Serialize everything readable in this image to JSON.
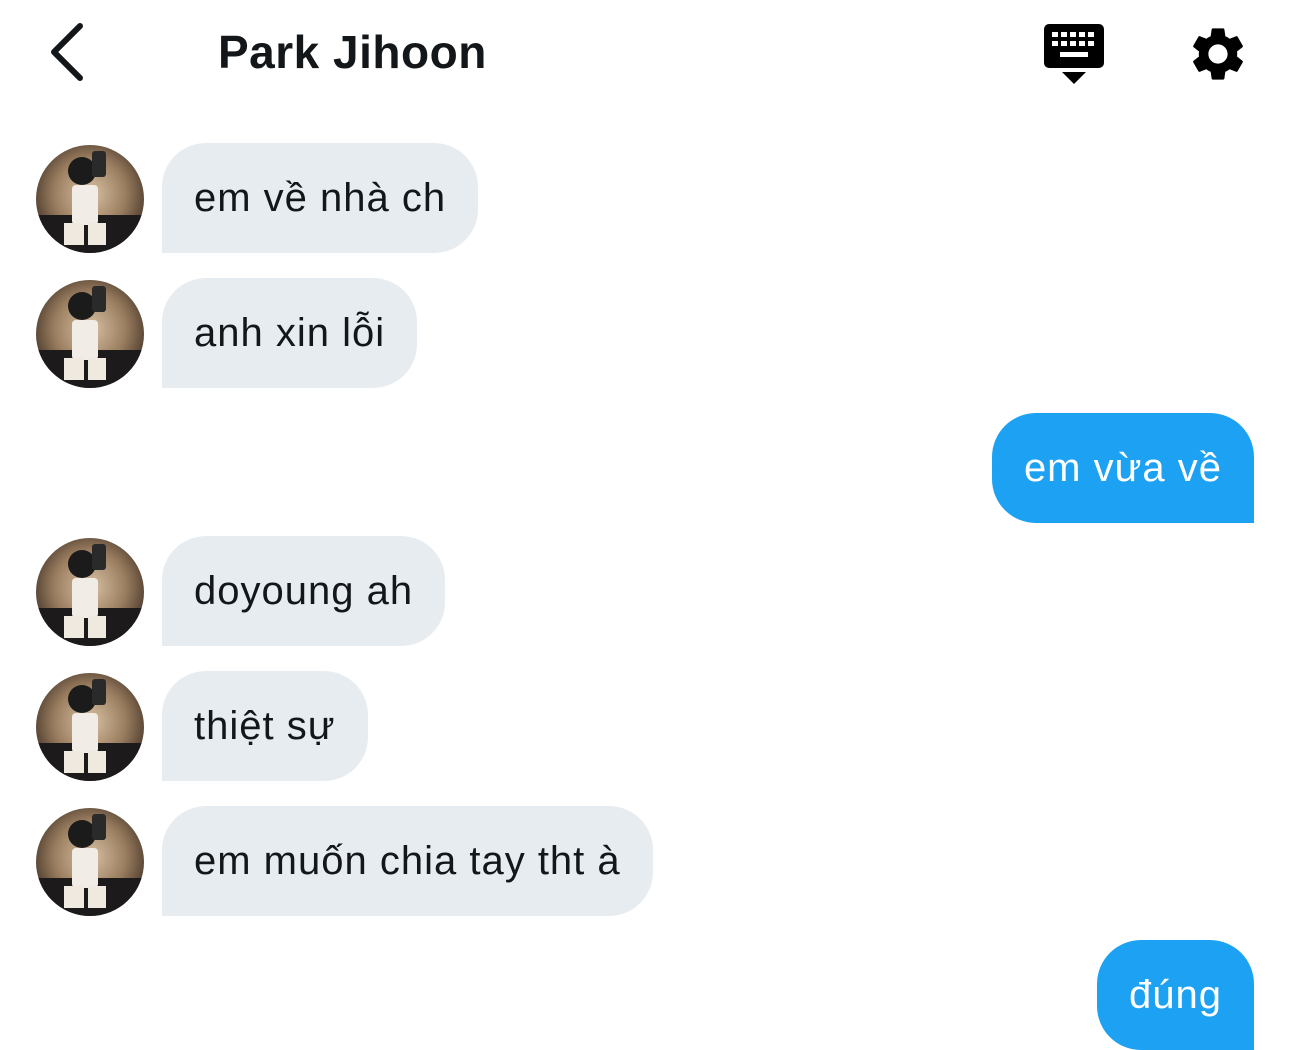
{
  "header": {
    "title": "Park Jihoon",
    "back_icon": "chevron-left-icon",
    "keyboard_icon": "keyboard-hide-icon",
    "settings_icon": "gear-icon"
  },
  "colors": {
    "incoming_bubble": "#e6ecf0",
    "outgoing_bubble": "#1da1f2",
    "text_dark": "#14171a",
    "text_light": "#ffffff"
  },
  "messages": [
    {
      "direction": "incoming",
      "text": "em về nhà ch"
    },
    {
      "direction": "incoming",
      "text": "anh xin lỗi"
    },
    {
      "direction": "outgoing",
      "text": "em vừa về"
    },
    {
      "direction": "incoming",
      "text": "doyoung ah"
    },
    {
      "direction": "incoming",
      "text": "thiệt sự"
    },
    {
      "direction": "incoming",
      "text": "em muốn chia tay tht à"
    },
    {
      "direction": "outgoing",
      "text": "đúng"
    }
  ]
}
